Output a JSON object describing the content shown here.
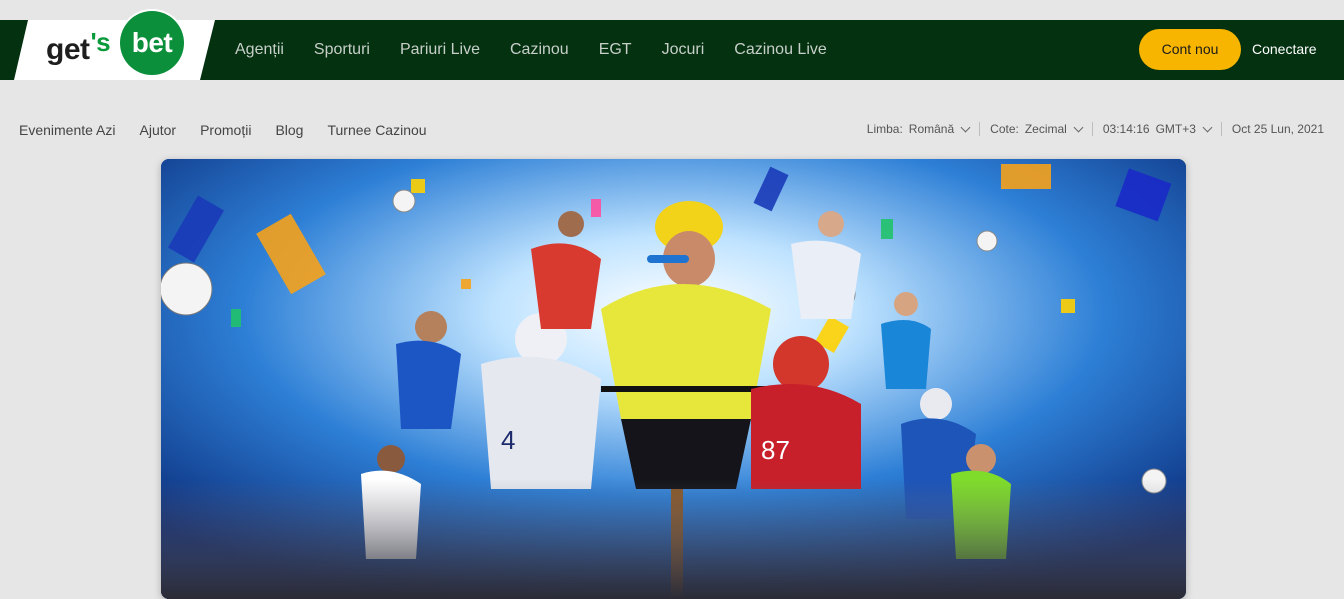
{
  "brand": {
    "logo_text": "get",
    "logo_apostrophe": "'s",
    "logo_circle_text": "bet",
    "accent": "#f7b500",
    "header_bg": "#043110",
    "logo_green": "#0b8f3a"
  },
  "main_nav": {
    "items": [
      {
        "label": "Agenții"
      },
      {
        "label": "Sporturi"
      },
      {
        "label": "Pariuri Live"
      },
      {
        "label": "Cazinou"
      },
      {
        "label": "EGT"
      },
      {
        "label": "Jocuri"
      },
      {
        "label": "Cazinou Live"
      }
    ]
  },
  "auth": {
    "register_label": "Cont nou",
    "login_label": "Conectare"
  },
  "sub_nav": {
    "items": [
      {
        "label": "Evenimente Azi"
      },
      {
        "label": "Ajutor"
      },
      {
        "label": "Promoții"
      },
      {
        "label": "Blog"
      },
      {
        "label": "Turnee Cazinou"
      }
    ]
  },
  "settings": {
    "language_label": "Limba:",
    "language_value": "Română",
    "odds_label": "Cote:",
    "odds_value": "Zecimal",
    "time_value": "03:14:16",
    "timezone_value": "GMT+3",
    "date_value": "Oct 25 Lun, 2021"
  },
  "hero": {
    "image_icon": "sports-collage-banner"
  }
}
